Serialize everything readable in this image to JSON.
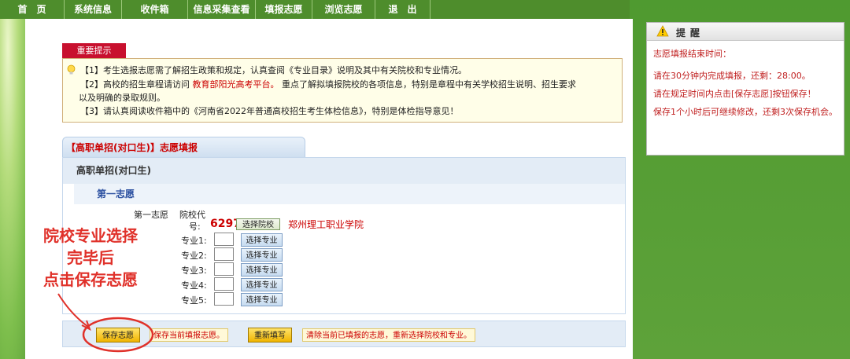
{
  "nav": {
    "items": [
      "首　页",
      "系统信息",
      "收件箱",
      "信息采集查看",
      "填报志愿",
      "浏览志愿",
      "退　出"
    ]
  },
  "notice": {
    "tab": "重要提示",
    "line1": "【1】考生选报志愿需了解招生政策和规定，认真查阅《专业目录》说明及其中有关院校和专业情况。",
    "line2_pre": "【2】高校的招生章程请访问",
    "line2_link": "教育部阳光高考平台。",
    "line2_post": "重点了解拟填报院校的各项信息，特别是章程中有关学校招生说明、招生要求",
    "line2_cont": "以及明确的录取规则。",
    "line3": "【3】请认真阅读收件箱中的《河南省2022年普通高校招生考生体检信息》，特别是体检指导意见！"
  },
  "form": {
    "header": "【高职单招(对口生)】志愿填报",
    "panel_title": "高职单招(对口生)",
    "sub_title": "第一志愿",
    "choice_label": "第一志愿",
    "code_label_1": "院校代",
    "code_label_2": "号:",
    "code_value": "6297",
    "select_school": "选择院校",
    "school_name": "郑州理工职业学院",
    "majors": [
      "专业1:",
      "专业2:",
      "专业3:",
      "专业4:",
      "专业5:"
    ],
    "select_major": "选择专业"
  },
  "actions": {
    "save": "保存志愿",
    "save_note": "保存当前填报志愿。",
    "reset": "重新填写",
    "reset_note": "清除当前已填报的志愿，重新选择院校和专业。"
  },
  "reminder": {
    "title": "提醒",
    "line1": "志愿填报结束时间：",
    "line2": "请在30分钟内完成填报，还剩：28:00。",
    "line3": "请在规定时间内点击[保存志愿]按钮保存！",
    "line4": "保存1个小时后可继续修改，还剩3次保存机会。"
  },
  "annotation": {
    "line1": "院校专业选择",
    "line2": "完毕后",
    "line3": "点击保存志愿"
  },
  "colors": {
    "nav_bg": "#4e8d2c",
    "accent_red": "#c8102e",
    "annotation_red": "#e0312a"
  }
}
